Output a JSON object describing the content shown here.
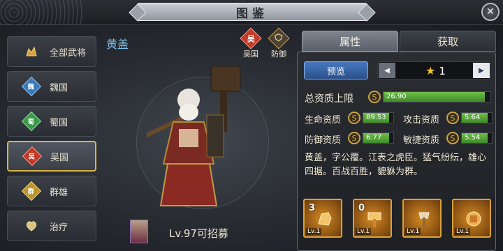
{
  "header": {
    "title": "图鉴",
    "close_symbol": "✕"
  },
  "nav": [
    {
      "label": "全部武将",
      "glyph": "",
      "color": "#d8a23a"
    },
    {
      "label": "魏国",
      "glyph": "魏",
      "color": "#3b7bb8"
    },
    {
      "label": "蜀国",
      "glyph": "蜀",
      "color": "#3a9a4a"
    },
    {
      "label": "吴国",
      "glyph": "吴",
      "color": "#c23a2a"
    },
    {
      "label": "群雄",
      "glyph": "群",
      "color": "#b8962a"
    },
    {
      "label": "治疗",
      "glyph": "",
      "color": "#d8c47a"
    }
  ],
  "nav_active_index": 3,
  "hero": {
    "name": "黄盖",
    "level_text": "Lv.97可招募",
    "faction": {
      "glyph": "吴",
      "label": "吴国",
      "color": "#c23a2a"
    },
    "role": {
      "label": "防御",
      "color": "#c9a24a"
    }
  },
  "tabs": {
    "attr": "属性",
    "get": "获取"
  },
  "preview": {
    "label": "预览",
    "stars": "1"
  },
  "stats": {
    "total": {
      "label": "总资质上限",
      "value": "26.90",
      "fill": 0.95
    },
    "hp": {
      "label": "生命资质",
      "value": "89.53",
      "fill": 0.85
    },
    "atk": {
      "label": "攻击资质",
      "value": "5.64",
      "fill": 0.85
    },
    "def": {
      "label": "防御资质",
      "value": "6.77",
      "fill": 0.85
    },
    "agi": {
      "label": "敏捷资质",
      "value": "5.54",
      "fill": 0.85
    }
  },
  "description": "黄盖，字公覆。江表之虎臣。猛气纷纭，雄心四据。百战百胜，貔貅为群。",
  "skills": [
    {
      "num": "3",
      "lv": "Lv.1"
    },
    {
      "num": "0",
      "lv": "Lv.1"
    },
    {
      "num": "",
      "lv": "Lv.1"
    },
    {
      "num": "",
      "lv": "Lv.1"
    }
  ]
}
